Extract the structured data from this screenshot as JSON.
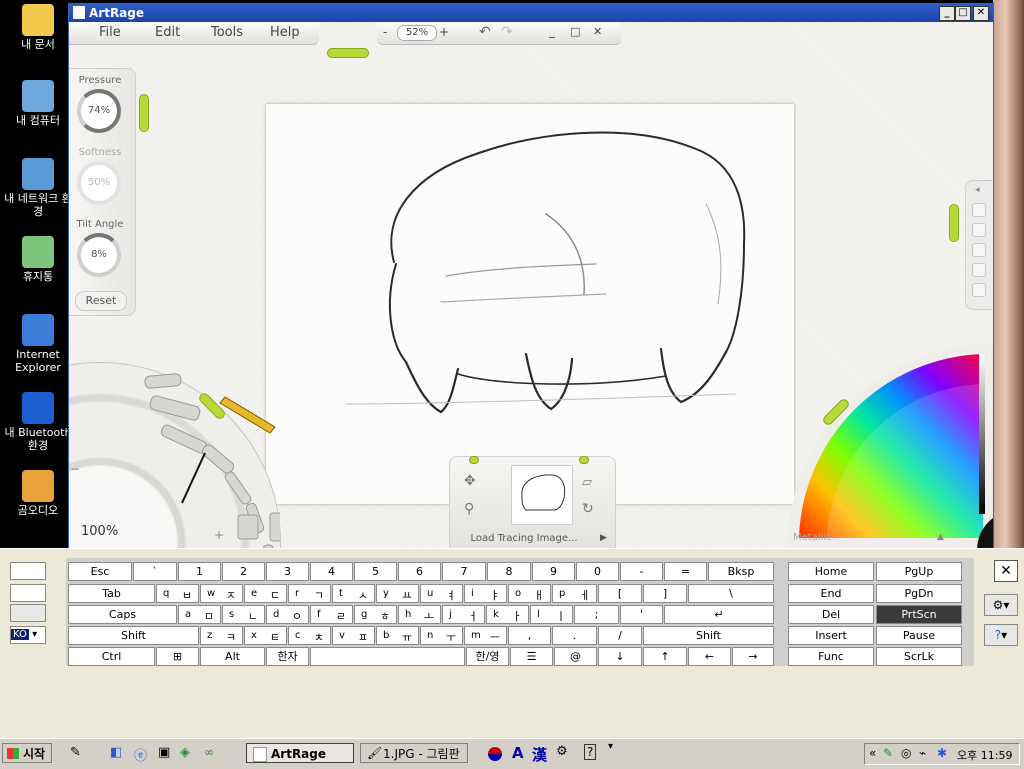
{
  "desktop_icons": [
    {
      "label": "내 문서",
      "icon": "my-documents-icon"
    },
    {
      "label": "내 컴퓨터",
      "icon": "my-computer-icon"
    },
    {
      "label": "내 네트워크 환경",
      "icon": "network-icon"
    },
    {
      "label": "휴지통",
      "icon": "recycle-bin-icon"
    },
    {
      "label": "Internet Explorer",
      "icon": "internet-explorer-icon"
    },
    {
      "label": "내 Bluetooth 환경",
      "icon": "bluetooth-icon"
    },
    {
      "label": "곰오디오",
      "icon": "gom-audio-icon"
    }
  ],
  "window": {
    "title": "ArtRage"
  },
  "menu": [
    "File",
    "Edit",
    "Tools",
    "Help"
  ],
  "zoom": {
    "minus": "-",
    "value": "52%",
    "plus": "+"
  },
  "props": {
    "pressure_label": "Pressure",
    "pressure_value": "74%",
    "softness_label": "Softness",
    "softness_value": "50%",
    "tilt_label": "Tilt Angle",
    "tilt_value": "8%",
    "reset": "Reset"
  },
  "canvas_zoom": "100%",
  "picker": {
    "metallic": "Metallic"
  },
  "tracing": {
    "label": "Load Tracing Image..."
  },
  "keyboard": {
    "row1": [
      [
        "Esc",
        ""
      ],
      [
        "`",
        ""
      ],
      [
        "1",
        ""
      ],
      [
        "2",
        ""
      ],
      [
        "3",
        ""
      ],
      [
        "4",
        ""
      ],
      [
        "5",
        ""
      ],
      [
        "6",
        ""
      ],
      [
        "7",
        ""
      ],
      [
        "8",
        ""
      ],
      [
        "9",
        ""
      ],
      [
        "0",
        ""
      ],
      [
        "-",
        ""
      ],
      [
        "=",
        ""
      ],
      [
        "Bksp",
        ""
      ]
    ],
    "row2": [
      [
        "Tab",
        ""
      ],
      [
        "q",
        "ㅂ"
      ],
      [
        "w",
        "ㅈ"
      ],
      [
        "e",
        "ㄷ"
      ],
      [
        "r",
        "ㄱ"
      ],
      [
        "t",
        "ㅅ"
      ],
      [
        "y",
        "ㅛ"
      ],
      [
        "u",
        "ㅕ"
      ],
      [
        "i",
        "ㅑ"
      ],
      [
        "o",
        "ㅐ"
      ],
      [
        "p",
        "ㅔ"
      ],
      [
        "[",
        ""
      ],
      [
        "]",
        ""
      ],
      [
        "\\",
        ""
      ]
    ],
    "row3": [
      [
        "Caps",
        ""
      ],
      [
        "a",
        "ㅁ"
      ],
      [
        "s",
        "ㄴ"
      ],
      [
        "d",
        "ㅇ"
      ],
      [
        "f",
        "ㄹ"
      ],
      [
        "g",
        "ㅎ"
      ],
      [
        "h",
        "ㅗ"
      ],
      [
        "j",
        "ㅓ"
      ],
      [
        "k",
        "ㅏ"
      ],
      [
        "l",
        "ㅣ"
      ],
      [
        ";",
        ""
      ],
      [
        "'",
        ""
      ],
      [
        "↵",
        ""
      ]
    ],
    "row4": [
      [
        "Shift",
        ""
      ],
      [
        "z",
        "ㅋ"
      ],
      [
        "x",
        "ㅌ"
      ],
      [
        "c",
        "ㅊ"
      ],
      [
        "v",
        "ㅍ"
      ],
      [
        "b",
        "ㅠ"
      ],
      [
        "n",
        "ㅜ"
      ],
      [
        "m",
        "ㅡ"
      ],
      [
        ",",
        ""
      ],
      [
        ".",
        ""
      ],
      [
        "/",
        ""
      ],
      [
        "Shift",
        ""
      ]
    ],
    "row5": [
      "Ctrl",
      "⊞",
      "Alt",
      "한자",
      "",
      "한/영",
      "☰",
      "@",
      "↓",
      "↑",
      "←",
      "→"
    ],
    "nav": [
      "Home",
      "PgUp",
      "End",
      "PgDn",
      "Del",
      "PrtScn",
      "Insert",
      "Pause",
      "Func",
      "ScrLk"
    ],
    "lang": "KO",
    "close": "✕"
  },
  "taskbar": {
    "start": "시작",
    "tasks": [
      "ArtRage",
      "1.JPG - 그림판"
    ],
    "ime": [
      "A",
      "漢"
    ],
    "clock": "오후 11:59",
    "expand": "«"
  },
  "colors": {
    "grip": "#b7d93a",
    "titlebar": "#2e5ec8"
  }
}
